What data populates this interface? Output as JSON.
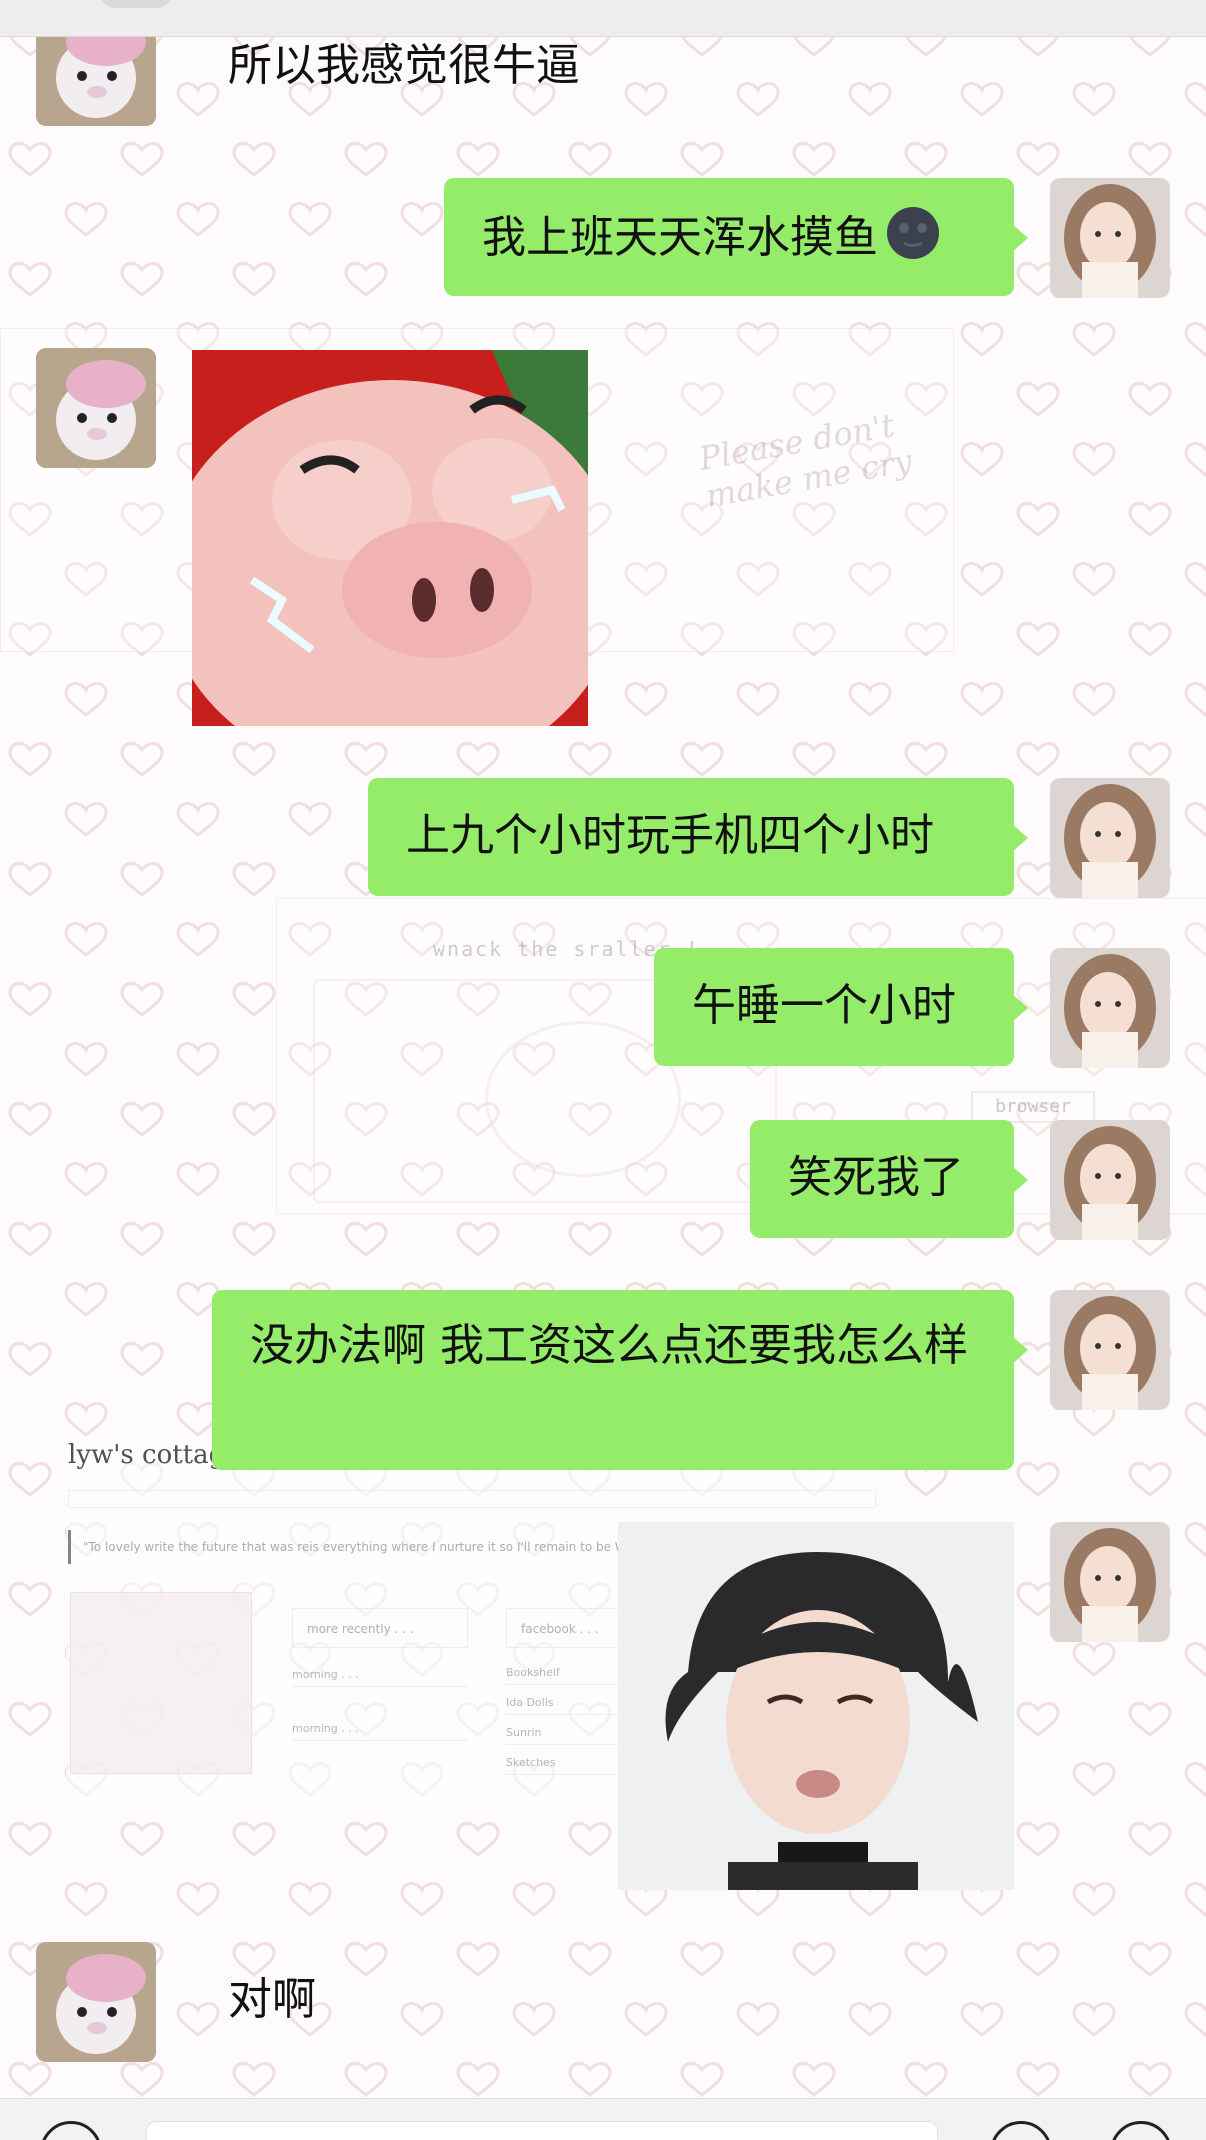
{
  "colors": {
    "bubble_green": "#95ec69",
    "wallpaper_heart": "#f1dede",
    "text": "#111111"
  },
  "messages": [
    {
      "side": "left",
      "type": "text",
      "text": "所以我感觉很牛逼",
      "avatar": "pig-plush-avatar"
    },
    {
      "side": "right",
      "type": "text",
      "text": "我上班天天浑水摸鱼",
      "emoji": "new-moon-face-emoji",
      "avatar": "girl-selfie-avatar"
    },
    {
      "side": "left",
      "type": "sticker",
      "sticker": "crying-pig-sticker",
      "avatar": "pig-plush-avatar"
    },
    {
      "side": "right",
      "type": "text",
      "text": "上九个小时玩手机四个小时",
      "avatar": "girl-selfie-avatar"
    },
    {
      "side": "right",
      "type": "text",
      "text": "午睡一个小时",
      "avatar": "girl-selfie-avatar"
    },
    {
      "side": "right",
      "type": "text",
      "text": "笑死我了",
      "avatar": "girl-selfie-avatar"
    },
    {
      "side": "right",
      "type": "text",
      "text": "没办法啊 我工资这么点还要我怎么样",
      "avatar": "girl-selfie-avatar"
    },
    {
      "side": "right",
      "type": "sticker",
      "sticker": "pouting-boy-photo",
      "avatar": "girl-selfie-avatar"
    },
    {
      "side": "left",
      "type": "text",
      "text": "对啊",
      "avatar": "pig-plush-avatar"
    }
  ],
  "wallpaper": {
    "script_text": "Please don't make me cry",
    "caption": "wnack the sraller !",
    "side_button": "browser",
    "cottage_title": "lyw's cottage",
    "cottage_quote": "\"To lovely write the future that was reis everything where I nurture it so I'll remain to be Wonderful\"",
    "cottage_box_1": "more recently . . .",
    "cottage_box_2": "facebook . . .",
    "cottage_row_1": "morning . . .",
    "cottage_row_2": "morning . . .",
    "cottage_links": [
      "Bookshelf",
      "Ida Dolls",
      "Sunrin",
      "Sketches"
    ]
  }
}
